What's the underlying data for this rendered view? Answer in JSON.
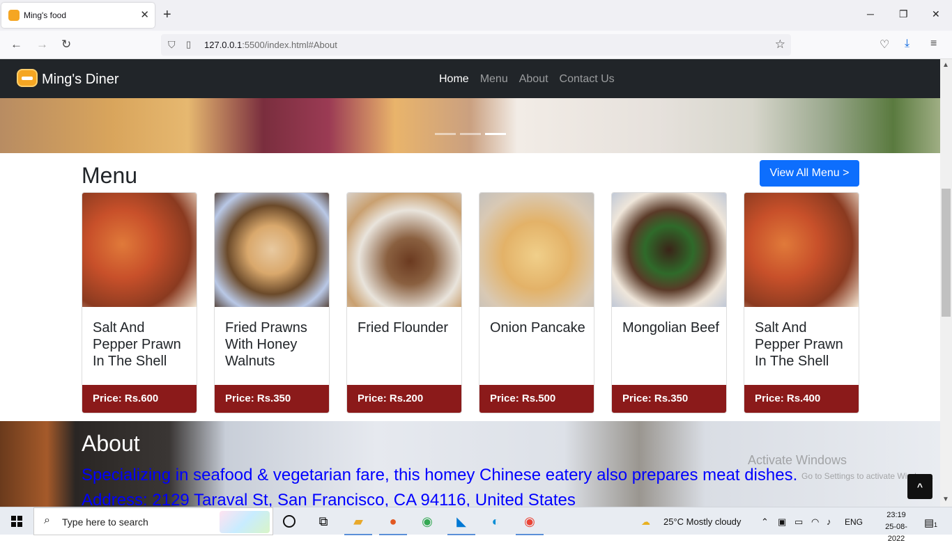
{
  "browser": {
    "tab_title": "Ming's food",
    "tab_close": "✕",
    "new_tab": "+",
    "url_host": "127.0.0.1",
    "url_rest": ":5500/index.html#About",
    "win_min": "─",
    "win_restore": "❐",
    "win_close": "✕"
  },
  "site": {
    "brand": "Ming's Diner",
    "nav": [
      "Home",
      "Menu",
      "About",
      "Contact Us"
    ],
    "active_nav": "Home"
  },
  "menu": {
    "heading": "Menu",
    "view_all": "View All Menu >",
    "items": [
      {
        "title": "Salt And Pepper Prawn In The Shell",
        "price": "Price: Rs.600"
      },
      {
        "title": "Fried Prawns With Honey Walnuts",
        "price": "Price: Rs.350"
      },
      {
        "title": "Fried Flounder",
        "price": "Price: Rs.200"
      },
      {
        "title": "Onion Pancake",
        "price": "Price: Rs.500"
      },
      {
        "title": "Mongolian Beef",
        "price": "Price: Rs.350"
      },
      {
        "title": "Salt And Pepper Prawn In The Shell",
        "price": "Price: Rs.400"
      }
    ]
  },
  "about": {
    "heading": "About",
    "text": "Specializing in seafood & vegetarian fare, this homey Chinese eatery also prepares meat dishes. Address: 2129 Taraval St, San Francisco, CA 94116, United States",
    "watermark_title": "Activate Windows",
    "watermark_sub": "Go to Settings to activate Windows.",
    "to_top": "^"
  },
  "taskbar": {
    "search_placeholder": "Type here to search",
    "weather": "25°C  Mostly cloudy",
    "lang": "ENG",
    "time": "23:19",
    "date": "25-08-2022",
    "notifications": "1"
  },
  "colors": {
    "site_nav_bg": "#212529",
    "primary_button": "#0d6efd",
    "price_bar": "#8b1a1a",
    "about_text": "#0000ff"
  }
}
